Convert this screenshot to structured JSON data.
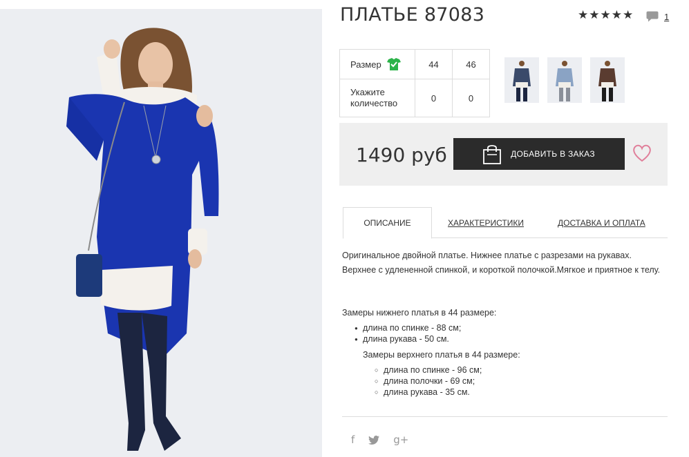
{
  "product": {
    "title": "ПЛАТЬЕ 87083",
    "rating_stars": 5,
    "reviews_count": "1"
  },
  "size_table": {
    "size_label": "Размер",
    "quantity_label_line1": "Укажите",
    "quantity_label_line2": "количество",
    "sizes": [
      "44",
      "46"
    ],
    "quantities": [
      "0",
      "0"
    ]
  },
  "thumbnails": [
    {
      "name": "navy-dress-thumb",
      "color": "#3a4a6a"
    },
    {
      "name": "light-blue-dress-thumb",
      "color": "#8aa3c4"
    },
    {
      "name": "brown-dress-thumb",
      "color": "#5a3c30"
    }
  ],
  "purchase": {
    "price": "1490 руб",
    "add_button_label": "ДОБАВИТЬ В ЗАКАЗ",
    "wishlist_icon": "heart-icon"
  },
  "tabs": [
    {
      "label": "ОПИСАНИЕ",
      "active": true
    },
    {
      "label": "ХАРАКТЕРИСТИКИ",
      "active": false
    },
    {
      "label": "ДОСТАВКА И ОПЛАТА",
      "active": false
    }
  ],
  "description": {
    "text": "Оригинальное двойной платье. Нижнее платье с разрезами на рукавах. Верхнее с удлененной спинкой, и короткой полочкой.Мягкое и приятное к телу.",
    "lower_dress_title": "Замеры нижнего платья в 44 размере:",
    "lower_dress_items": [
      "длина по спинке - 88 см;",
      "длина рукава - 50 см."
    ],
    "upper_dress_title": "Замеры верхнего платья в 44 размере:",
    "upper_dress_items": [
      "длина по спинке - 96 см;",
      "длина полочки - 69 см;",
      "длина рукава - 35 см."
    ]
  },
  "social": {
    "facebook": "f",
    "twitter": "twitter-icon",
    "googleplus": "g+"
  },
  "colors": {
    "dress_blue": "#1a35b0",
    "button_dark": "#2b2b2b",
    "heart_pink": "#e07f9a",
    "check_green": "#2cb34a"
  }
}
